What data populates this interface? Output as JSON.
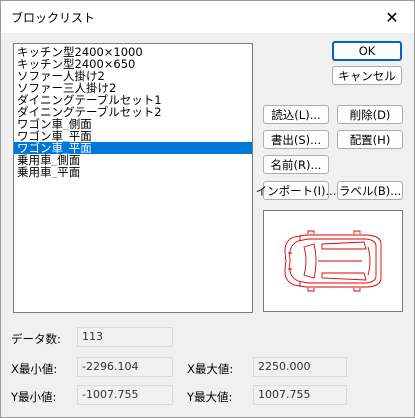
{
  "window": {
    "title": "ブロックリスト",
    "close_glyph": "✕"
  },
  "block_list": {
    "items": [
      "キッチン型2400×1000",
      "キッチン型2400×650",
      "ソファー人掛け2",
      "ソファー三人掛け2",
      "ダイニングテーブルセット1",
      "ダイニングテーブルセット2",
      "ワゴン車_側面",
      "ワゴン車_平面",
      "ワゴン車_平面",
      "乗用車_側面",
      "乗用車_平面"
    ],
    "selected_index": 8
  },
  "buttons": {
    "ok": "OK",
    "cancel": "キャンセル",
    "read": "読込(L)...",
    "delete": "削除(D)",
    "write": "書出(S)...",
    "place": "配置(H)",
    "rename": "名前(R)...",
    "import": "インポート(I)...",
    "label": "ラベル(B)..."
  },
  "stats": {
    "count_label": "データ数:",
    "count_value": "113",
    "xmin_label": "X最小値:",
    "xmin_value": "-2296.104",
    "xmax_label": "X最大値:",
    "xmax_value": "2250.000",
    "ymin_label": "Y最小値:",
    "ymin_value": "-1007.755",
    "ymax_label": "Y最大値:",
    "ymax_value": "1007.755"
  },
  "colors": {
    "selection": "#0078d7",
    "preview_stroke": "#e00000",
    "default_button_border": "#0067c0"
  }
}
